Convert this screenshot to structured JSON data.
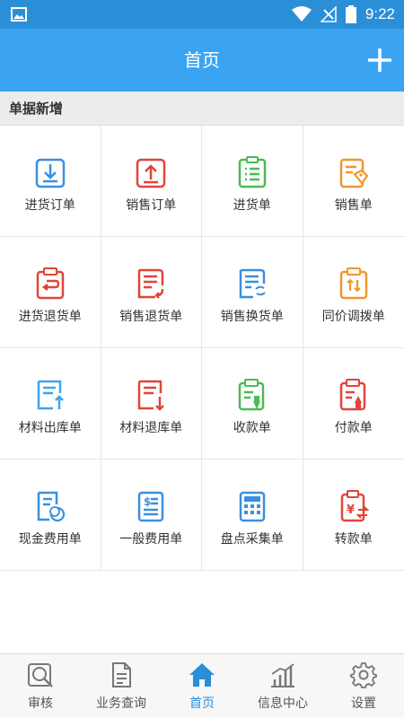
{
  "status_bar": {
    "time": "9:22"
  },
  "app_bar": {
    "title": "首页"
  },
  "section": {
    "title": "单据新增"
  },
  "grid_items": [
    {
      "label": "进货订单",
      "icon": "purchase-order-icon",
      "color": "#3a8fe0"
    },
    {
      "label": "销售订单",
      "icon": "sales-order-icon",
      "color": "#e0453a"
    },
    {
      "label": "进货单",
      "icon": "purchase-checklist-icon",
      "color": "#4cba55"
    },
    {
      "label": "销售单",
      "icon": "sales-tag-icon",
      "color": "#f0962c"
    },
    {
      "label": "进货退货单",
      "icon": "purchase-return-icon",
      "color": "#e0453a"
    },
    {
      "label": "销售退货单",
      "icon": "sales-return-icon",
      "color": "#e0453a"
    },
    {
      "label": "销售换货单",
      "icon": "sales-exchange-icon",
      "color": "#3a8fe0"
    },
    {
      "label": "同价调拨单",
      "icon": "transfer-icon",
      "color": "#f0962c"
    },
    {
      "label": "材料出库单",
      "icon": "material-out-icon",
      "color": "#3aa4f3"
    },
    {
      "label": "材料退库单",
      "icon": "material-return-icon",
      "color": "#e0453a"
    },
    {
      "label": "收款单",
      "icon": "receipt-icon",
      "color": "#4cba55"
    },
    {
      "label": "付款单",
      "icon": "payment-icon",
      "color": "#e0453a"
    },
    {
      "label": "现金费用单",
      "icon": "cash-expense-icon",
      "color": "#3a8fe0"
    },
    {
      "label": "一般费用单",
      "icon": "general-expense-icon",
      "color": "#3a8fe0"
    },
    {
      "label": "盘点采集单",
      "icon": "calculator-icon",
      "color": "#3a8fe0"
    },
    {
      "label": "转款单",
      "icon": "transfer-funds-icon",
      "color": "#e0453a"
    }
  ],
  "tab_bar": [
    {
      "label": "审核",
      "icon": "review-magnifier-icon",
      "active": false
    },
    {
      "label": "业务查询",
      "icon": "document-query-icon",
      "active": false
    },
    {
      "label": "首页",
      "icon": "home-icon",
      "active": true
    },
    {
      "label": "信息中心",
      "icon": "chart-icon",
      "active": false
    },
    {
      "label": "设置",
      "icon": "gear-icon",
      "active": false
    }
  ]
}
